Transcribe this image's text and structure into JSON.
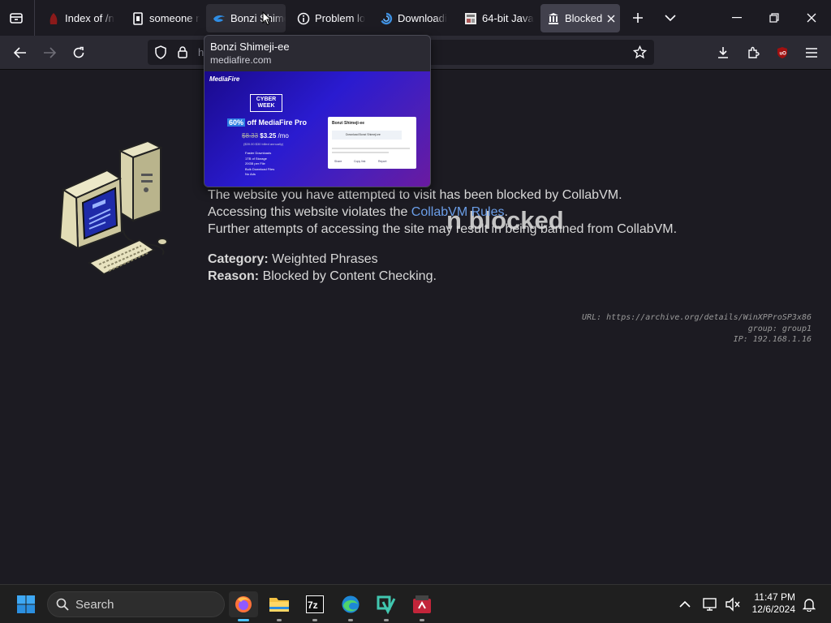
{
  "tabs": [
    {
      "label": "Index of /n"
    },
    {
      "label": "someone n"
    },
    {
      "label": "Bonzi Shimeji-ee"
    },
    {
      "label": "Problem lo"
    },
    {
      "label": "Downloadi"
    },
    {
      "label": "64-bit Java"
    },
    {
      "label": "Blocked"
    }
  ],
  "urlbar": {
    "text": "h"
  },
  "preview": {
    "title": "Bonzi Shimeji-ee",
    "url": "mediafire.com",
    "thumb": {
      "brand": "MediaFire",
      "promo": "CYBER WEEK",
      "discount": "60%",
      "offer": "off MediaFire Pro",
      "old_price": "$8.33",
      "price": "$3.25",
      "per": "/mo",
      "billed": "($39.00 $30 billed annually)",
      "features": [
        "Faster Downloads",
        "1TB of Storage",
        "20GB per File",
        "Bulk Download Files",
        "No Ads"
      ],
      "card_title": "Bonzi Shimeji-ee",
      "card_line": "Download Bonzi Shimeji-ee",
      "card_actions": [
        "Share",
        "Copy link",
        "Report"
      ]
    }
  },
  "page": {
    "heading": "n blocked",
    "line1": "The website you have attempted to visit has been blocked by CollabVM.",
    "line2_pre": "Accessing this website violates the ",
    "line2_link": "CollabVM Rules",
    "line2_post": ".",
    "line3": "Further attempts of accessing the site may result in being banned from CollabVM.",
    "category_label": "Category:",
    "category_value": "Weighted Phrases",
    "reason_label": "Reason:",
    "reason_value": "Blocked by Content Checking.",
    "url_line": "URL: https://archive.org/details/WinXPProSP3x86",
    "group_line": "group: group1",
    "ip_line": "IP: 192.168.1.16"
  },
  "taskbar": {
    "search_label": "Search",
    "time": "11:47 PM",
    "date": "12/6/2024"
  },
  "colors": {
    "accent": "#4cc2ff",
    "link": "#6b9ee8",
    "background": "#1c1b22"
  }
}
